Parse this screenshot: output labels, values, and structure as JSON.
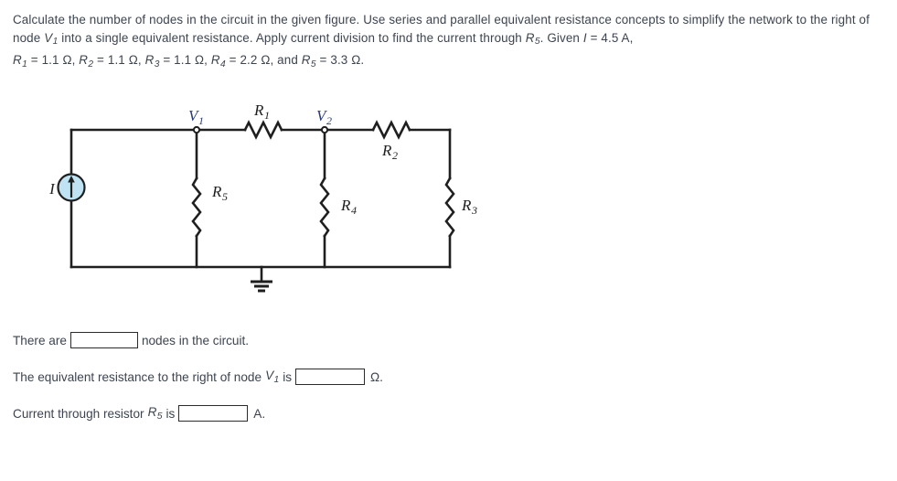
{
  "problem": {
    "text_part1": "Calculate the number of nodes in the circuit in the given figure. Use series and parallel equivalent resistance concepts to simplify the network to the right of node ",
    "node_ref": "V",
    "node_ref_sub": "1",
    "text_part2": " into a single equivalent resistance. Apply current division to find the current through ",
    "r5_sym": "R",
    "r5_sub": "5",
    "text_part3": ". Given ",
    "current_sym": "I",
    "current_eq": " = 4.5 A, ",
    "values": [
      {
        "sym": "R",
        "sub": "1",
        "eq": " = 1.1 Ω, "
      },
      {
        "sym": "R",
        "sub": "2",
        "eq": " = 1.1 Ω, "
      },
      {
        "sym": "R",
        "sub": "3",
        "eq": " = 1.1 Ω, "
      },
      {
        "sym": "R",
        "sub": "4",
        "eq": " = 2.2 Ω, and "
      },
      {
        "sym": "R",
        "sub": "5",
        "eq": " = 3.3 Ω."
      }
    ]
  },
  "circuit": {
    "source_label": "I",
    "source_type": "current-source",
    "source_color": "#bfe3f2",
    "node_label_color": "#2b3c7a",
    "wire_color": "#1f1f1f",
    "nodes": [
      {
        "name": "V",
        "sub": "1"
      },
      {
        "name": "V",
        "sub": "2"
      }
    ],
    "resistors": [
      {
        "name": "R",
        "sub": "1",
        "orientation": "horizontal"
      },
      {
        "name": "R",
        "sub": "2",
        "orientation": "horizontal"
      },
      {
        "name": "R",
        "sub": "3",
        "orientation": "vertical"
      },
      {
        "name": "R",
        "sub": "4",
        "orientation": "vertical"
      },
      {
        "name": "R",
        "sub": "5",
        "orientation": "vertical"
      }
    ],
    "ground_symbol": "ground"
  },
  "answers": {
    "line1_pre": "There are",
    "line1_post": "nodes in the circuit.",
    "line1_value": "",
    "line1_placeholder": "",
    "line2_pre": "The equivalent resistance to the right of node",
    "line2_node": "V",
    "line2_node_sub": "1",
    "line2_is": "is",
    "line2_unit": "Ω.",
    "line2_value": "",
    "line2_placeholder": "",
    "line3_pre": "Current through resistor",
    "line3_sym": "R",
    "line3_sub": "5",
    "line3_is": "is",
    "line3_unit": "A.",
    "line3_value": "",
    "line3_placeholder": ""
  }
}
